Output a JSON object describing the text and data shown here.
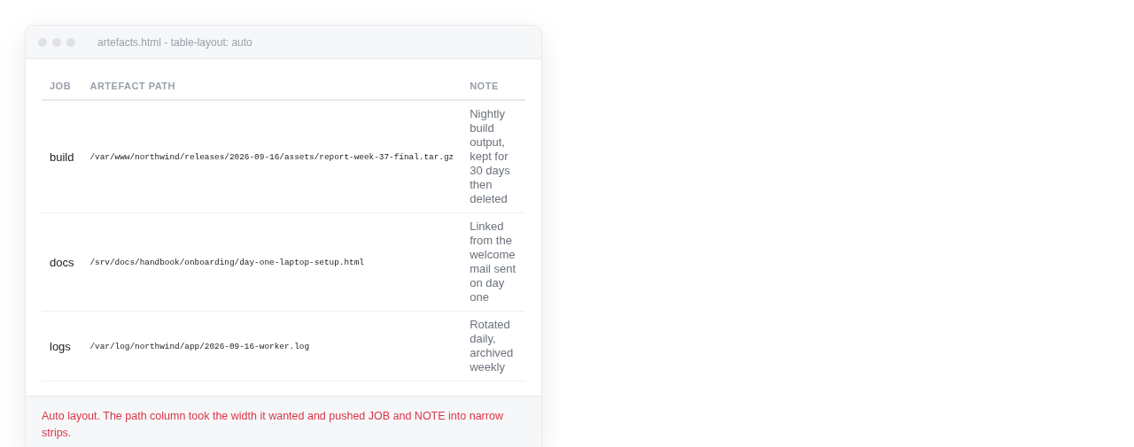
{
  "window": {
    "title": "artefacts.html - table-layout: auto"
  },
  "table": {
    "columns": [
      "JOB",
      "ARTEFACT PATH",
      "NOTE"
    ],
    "rows": [
      {
        "job": "build",
        "path": "/var/www/northwind/releases/2026-09-16/assets/report-week-37-final.tar.gz",
        "note": "Nightly build output, kept for 30 days then deleted"
      },
      {
        "job": "docs",
        "path": "/srv/docs/handbook/onboarding/day-one-laptop-setup.html",
        "note": "Linked from the welcome mail sent on day one"
      },
      {
        "job": "logs",
        "path": "/var/log/northwind/app/2026-09-16-worker.log",
        "note": "Rotated daily, archived weekly"
      }
    ]
  },
  "footer": {
    "message": "Auto layout. The path column took the width it wanted and pushed JOB and NOTE into narrow strips."
  }
}
